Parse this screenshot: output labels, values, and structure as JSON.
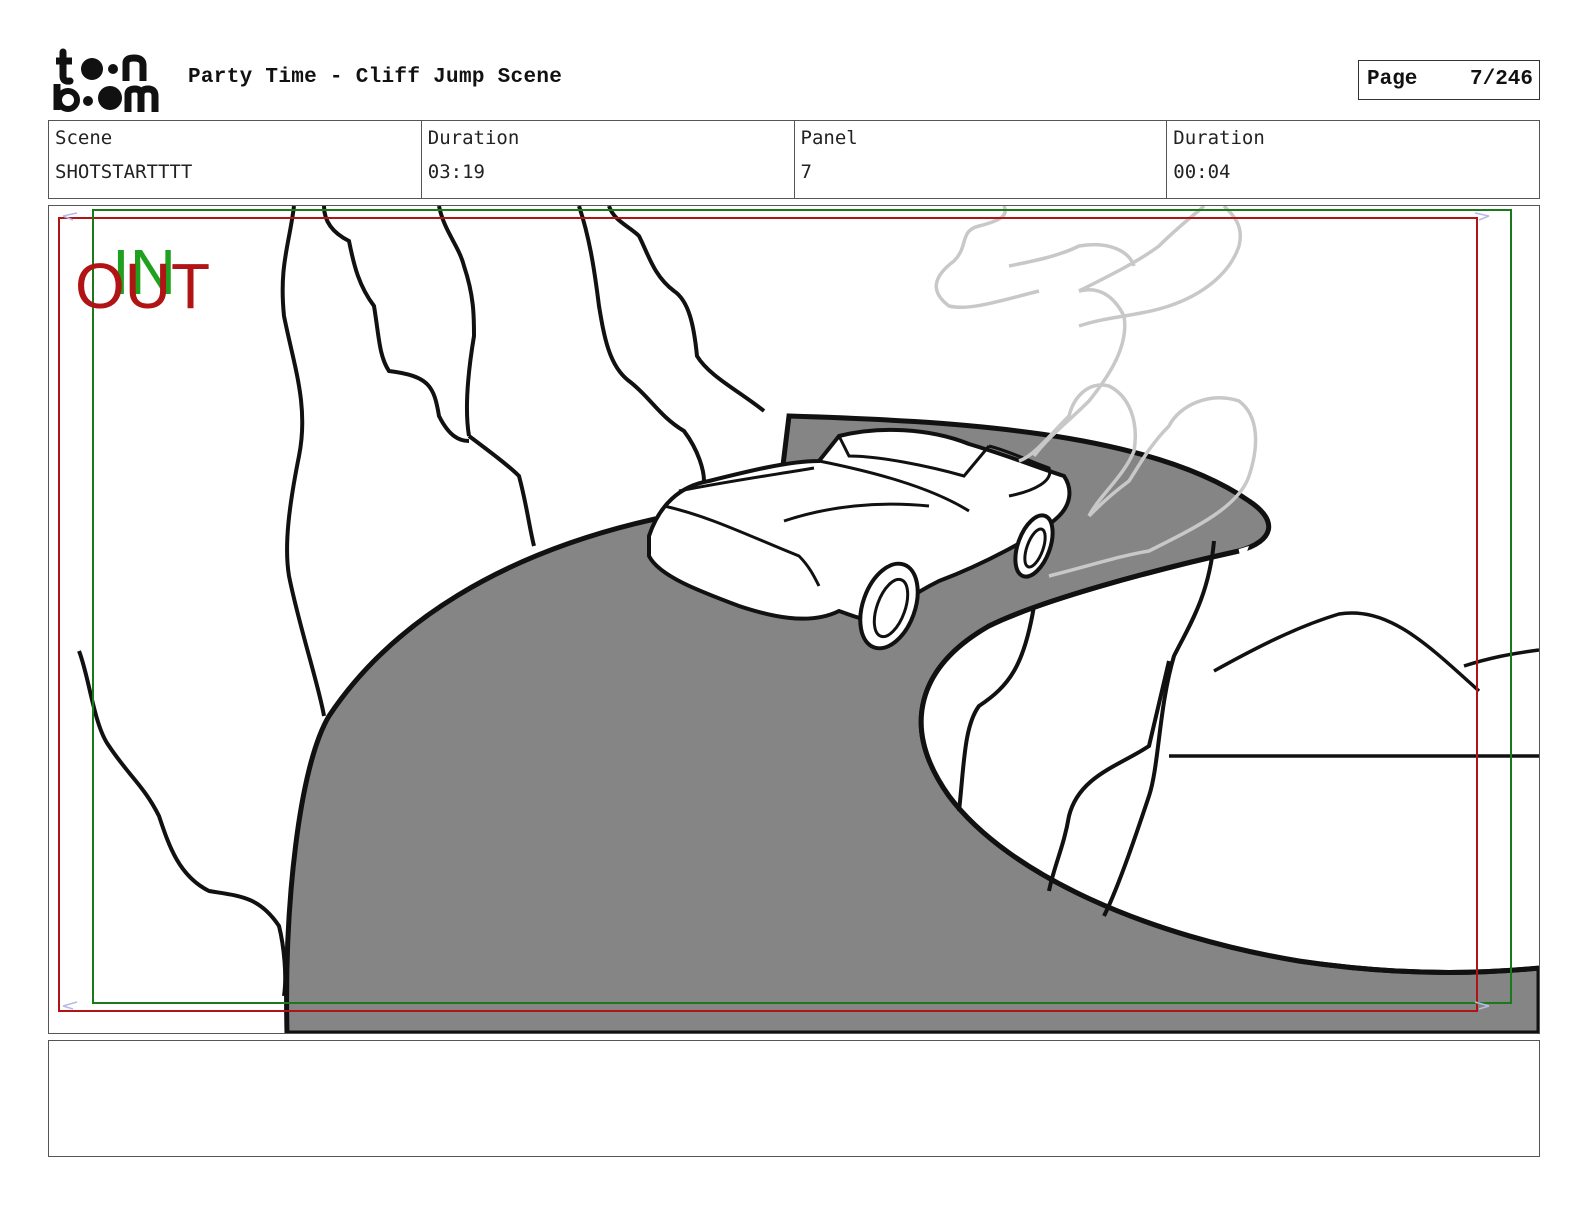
{
  "header": {
    "logo_text": "toon boom",
    "title": "Party Time - Cliff Jump Scene",
    "page_label": "Page",
    "page_value": "7/246"
  },
  "info": {
    "scene_label": "Scene",
    "scene_value": "SHOTSTARTTTT",
    "scene_duration_label": "Duration",
    "scene_duration_value": "03:19",
    "panel_label": "Panel",
    "panel_value": "7",
    "panel_duration_label": "Duration",
    "panel_duration_value": "00:04"
  },
  "panel": {
    "marker_out": "OUT",
    "marker_in": "IN",
    "out_color": "#b01414",
    "in_color": "#1fa01f",
    "road_color": "#858585",
    "smoke_color": "#c8c8c8"
  },
  "notes": {
    "text": ""
  }
}
